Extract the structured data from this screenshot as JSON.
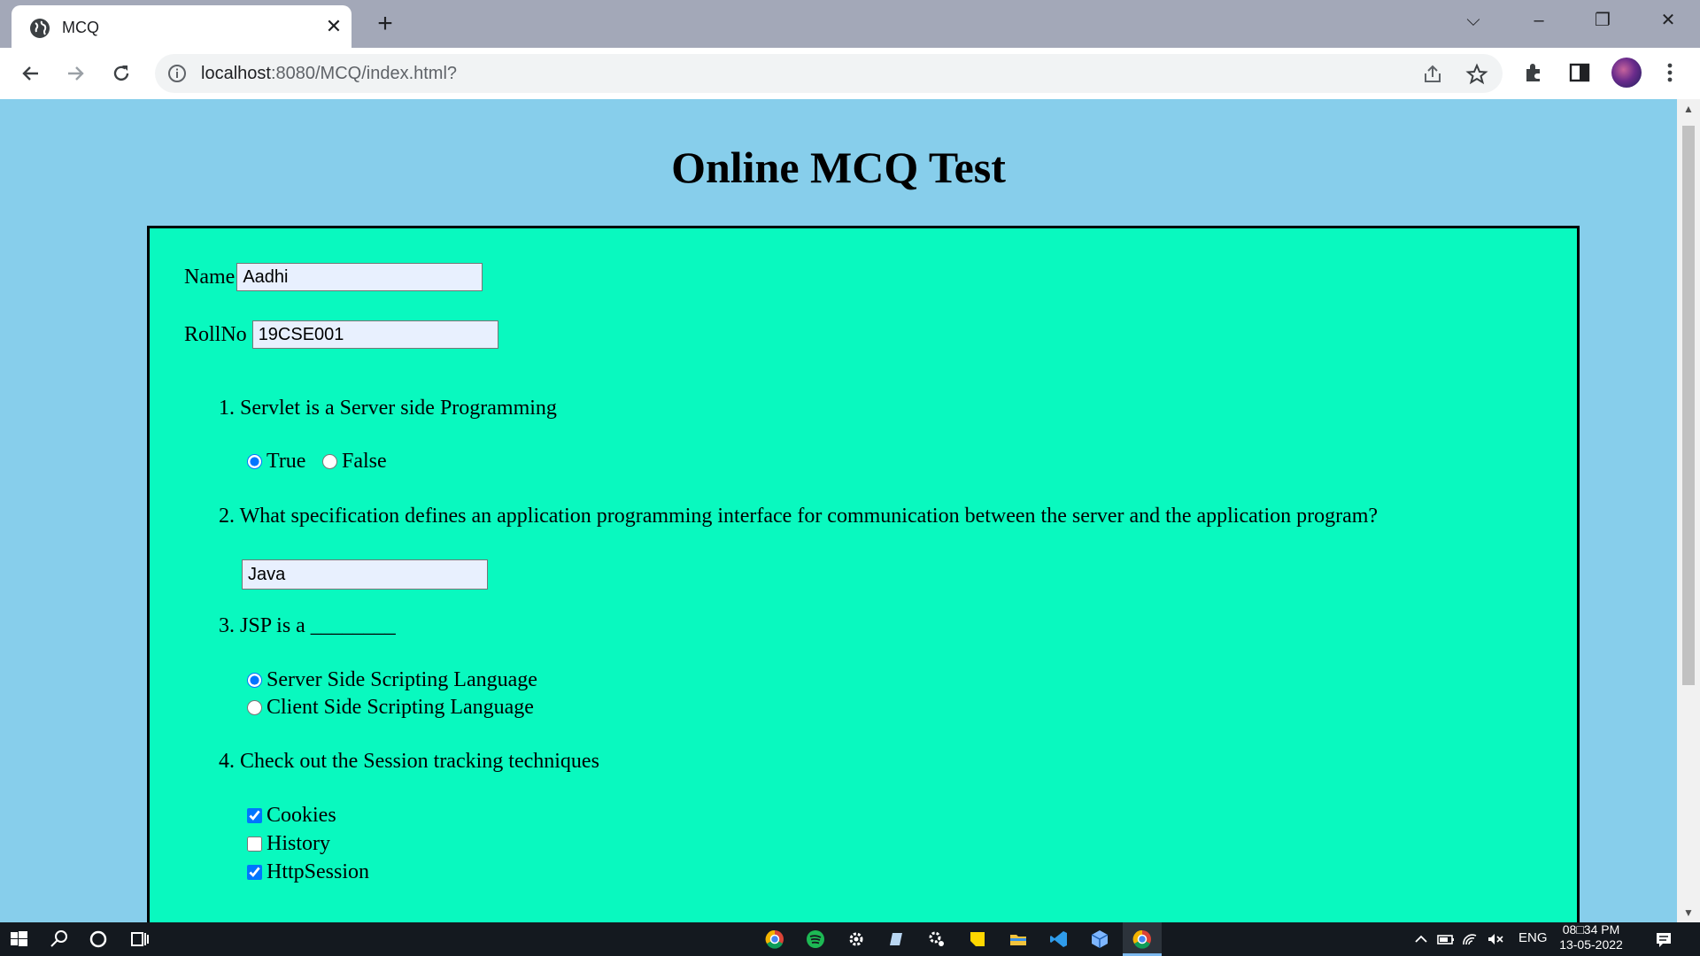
{
  "browser": {
    "tab": {
      "title": "MCQ"
    },
    "url": {
      "host": "localhost",
      "rest": ":8080/MCQ/index.html?"
    }
  },
  "page": {
    "title": "Online MCQ Test",
    "name_label": "Name",
    "name_value": "Aadhi",
    "rollno_label": "RollNo",
    "rollno_value": "19CSE001",
    "questions": [
      {
        "number": "1.",
        "text": "Servlet is a Server side Programming",
        "options": [
          {
            "label": "True",
            "checked": true
          },
          {
            "label": "False",
            "checked": false
          }
        ]
      },
      {
        "number": "2.",
        "text": "What specification defines an application programming interface for communication between the server and the application program?",
        "answer": "Java"
      },
      {
        "number": "3.",
        "text": "JSP is a ________",
        "options": [
          {
            "label": "Server Side Scripting Language",
            "checked": true
          },
          {
            "label": "Client Side Scripting Language",
            "checked": false
          }
        ]
      },
      {
        "number": "4.",
        "text": "Check out the Session tracking techniques",
        "options": [
          {
            "label": "Cookies",
            "checked": true
          },
          {
            "label": "History",
            "checked": false
          },
          {
            "label": "HttpSession",
            "checked": true
          }
        ]
      }
    ]
  },
  "taskbar": {
    "language": "ENG",
    "time": "08□34 PM",
    "date": "13-05-2022"
  },
  "colors": {
    "page_background": "#87ceeb",
    "form_background": "#09f9bf"
  }
}
